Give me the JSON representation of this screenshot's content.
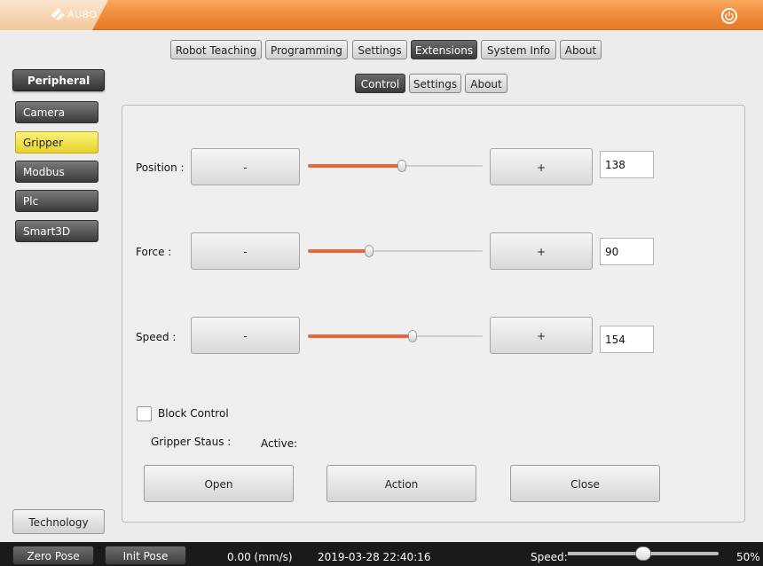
{
  "app": {
    "logo_text": "AUBO",
    "accent_color": "#ef8a38"
  },
  "top_tabs": [
    {
      "label": "Robot Teaching",
      "active": false
    },
    {
      "label": "Programming",
      "active": false
    },
    {
      "label": "Settings",
      "active": false
    },
    {
      "label": "Extensions",
      "active": true
    },
    {
      "label": "System Info",
      "active": false
    },
    {
      "label": "About",
      "active": false
    }
  ],
  "sub_tabs": [
    {
      "label": "Control",
      "active": true
    },
    {
      "label": "Settings",
      "active": false
    },
    {
      "label": "About",
      "active": false
    }
  ],
  "sidebar": {
    "header": "Peripheral",
    "items": [
      {
        "label": "Camera",
        "selected": false
      },
      {
        "label": "Gripper",
        "selected": true
      },
      {
        "label": "Modbus",
        "selected": false
      },
      {
        "label": "Plc",
        "selected": false
      },
      {
        "label": "Smart3D",
        "selected": false
      }
    ],
    "footer": "Technology"
  },
  "gripper": {
    "position": {
      "label": "Position :",
      "minus": "-",
      "plus": "+",
      "value": "138",
      "slider_fraction": 0.54
    },
    "force": {
      "label": "Force :",
      "minus": "-",
      "plus": "+",
      "value": "90",
      "slider_fraction": 0.35
    },
    "speed": {
      "label": "Speed :",
      "minus": "-",
      "plus": "+",
      "value": "154",
      "slider_fraction": 0.6
    },
    "block_control_label": "Block Control",
    "block_control_checked": false,
    "status_label": "Gripper Staus :",
    "status_value": "Active:",
    "open_label": "Open",
    "action_label": "Action",
    "close_label": "Close"
  },
  "statusbar": {
    "zero_pose": "Zero Pose",
    "init_pose": "Init Pose",
    "velocity": "0.00  (mm/s)",
    "datetime": "2019-03-28 22:40:16",
    "speed_label": "Speed:",
    "speed_percent": "50%",
    "speed_fraction": 0.5
  }
}
